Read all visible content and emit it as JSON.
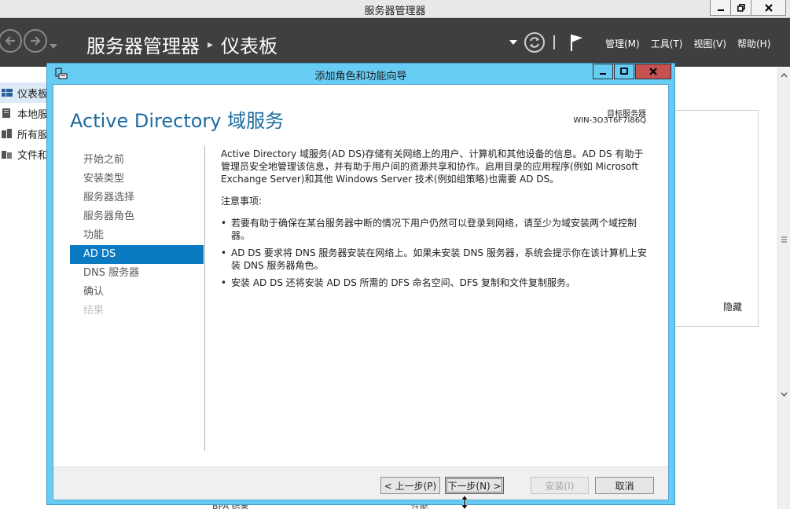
{
  "server_manager": {
    "window_title": "服务器管理器",
    "breadcrumb": [
      "服务器管理器",
      "仪表板"
    ],
    "menu": [
      "管理(M)",
      "工具(T)",
      "视图(V)",
      "帮助(H)"
    ],
    "sidebar": [
      {
        "label": "仪表板",
        "active": true
      },
      {
        "label": "本地服务器"
      },
      {
        "label": "所有服务器"
      },
      {
        "label": "文件和存储服务"
      }
    ],
    "hide_label": "隐藏",
    "bottom_fragments": [
      "BPA 结果",
      "性能"
    ]
  },
  "wizard": {
    "title": "添加角色和功能向导",
    "heading": "Active Directory 域服务",
    "target_label": "目标服务器",
    "target_value": "WIN-3O3T6F7I86Q",
    "steps": [
      {
        "label": "开始之前",
        "state": "normal"
      },
      {
        "label": "安装类型",
        "state": "normal"
      },
      {
        "label": "服务器选择",
        "state": "normal"
      },
      {
        "label": "服务器角色",
        "state": "normal"
      },
      {
        "label": "功能",
        "state": "normal"
      },
      {
        "label": "AD DS",
        "state": "current"
      },
      {
        "label": "DNS 服务器",
        "state": "normal"
      },
      {
        "label": "确认",
        "state": "normal"
      },
      {
        "label": "结果",
        "state": "disabled"
      }
    ],
    "intro": "Active Directory 域服务(AD DS)存储有关网络上的用户、计算机和其他设备的信息。AD DS 有助于管理员安全地管理该信息，并有助于用户间的资源共享和协作。启用目录的应用程序(例如 Microsoft Exchange Server)和其他 Windows Server 技术(例如组策略)也需要 AD DS。",
    "notes_heading": "注意事项:",
    "notes": [
      "若要有助于确保在某台服务器中断的情况下用户仍然可以登录到网络，请至少为域安装两个域控制器。",
      "AD DS 要求将 DNS 服务器安装在网络上。如果未安装 DNS 服务器，系统会提示你在该计算机上安装 DNS 服务器角色。",
      "安装 AD DS 还将安装 AD DS 所需的 DFS 命名空间、DFS 复制和文件复制服务。"
    ],
    "buttons": {
      "prev": "< 上一步(P)",
      "next": "下一步(N) >",
      "install": "安装(I)",
      "cancel": "取消"
    }
  },
  "colors": {
    "wizard_frame": "#66ccf3",
    "heading_blue": "#1c6ba0",
    "current_step": "#0a7bc3",
    "header_bg": "#3f3f3f",
    "close_red": "#c75050"
  }
}
